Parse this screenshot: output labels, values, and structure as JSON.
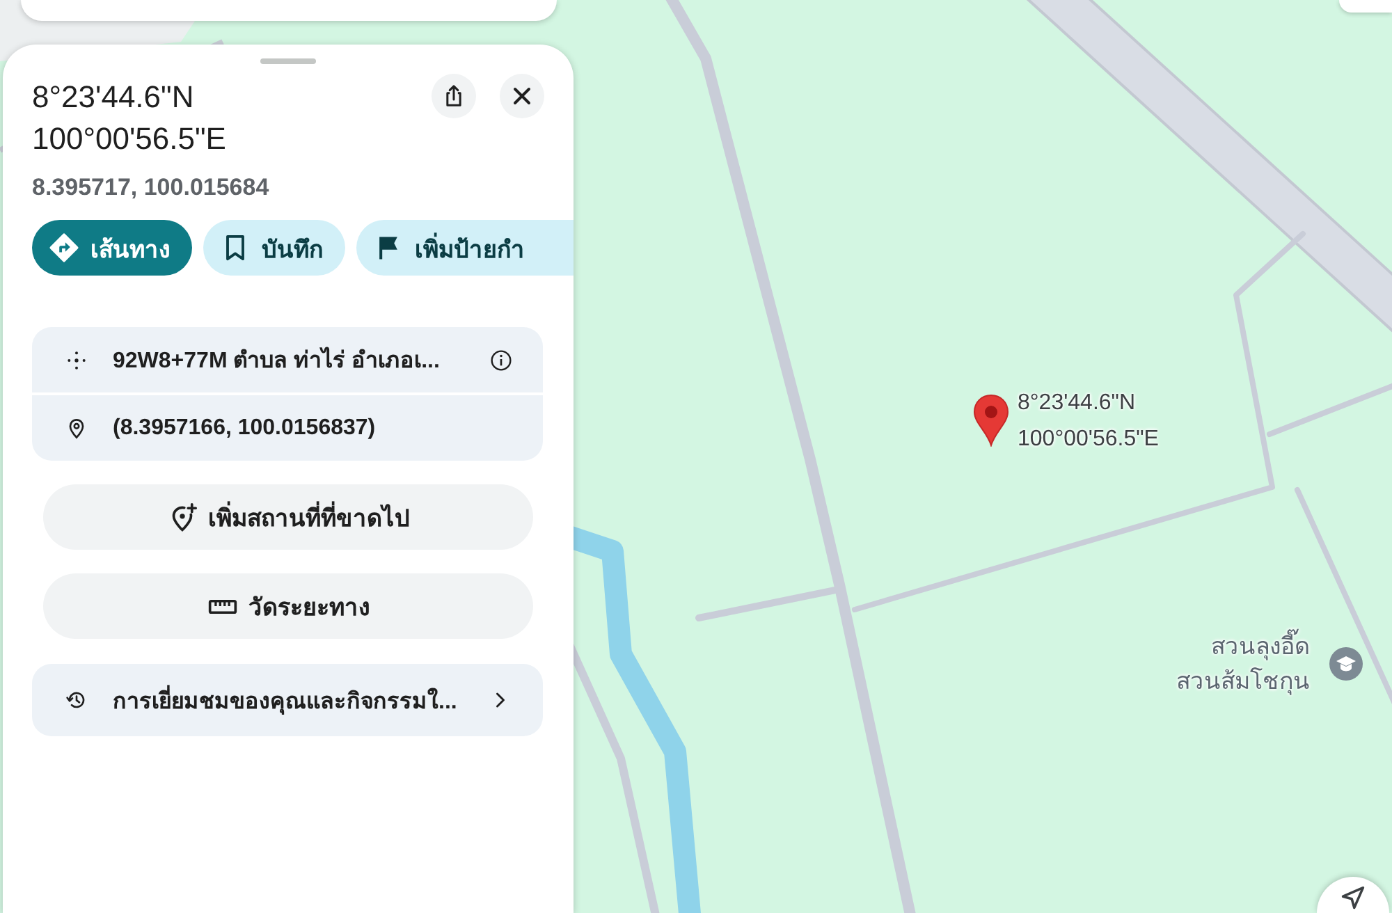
{
  "place_panel": {
    "title_lines": [
      "8°23'44.6\"N",
      "100°00'56.5\"E"
    ],
    "decimal_coordinates": "8.395717, 100.015684",
    "action_chips": [
      {
        "kind": "directions",
        "label": "เส้นทาง"
      },
      {
        "kind": "save",
        "label": "บันทึก"
      },
      {
        "kind": "label",
        "label": "เพิ่มป้ายกำ"
      }
    ],
    "details": [
      {
        "kind": "plus_code",
        "text": "92W8+77M ตำบล ท่าไร่ อำเภอเ..."
      },
      {
        "kind": "coordinates",
        "text": "(8.3957166, 100.0156837)"
      }
    ],
    "buttons": [
      {
        "kind": "add_place",
        "label": "เพิ่มสถานที่ที่ขาดไป"
      },
      {
        "kind": "measure",
        "label": "วัดระยะทาง"
      }
    ],
    "activity_link": {
      "label": "การเยี่ยมชมของคุณและกิจกรรมใ..."
    }
  },
  "map": {
    "pin": {
      "label_lines": [
        "8°23'44.6\"N",
        "100°00'56.5\"E"
      ]
    },
    "places": [
      {
        "name_lines": [
          "สวนลุงอี๊ด",
          "สวนส้มโชกุน"
        ]
      }
    ]
  }
}
